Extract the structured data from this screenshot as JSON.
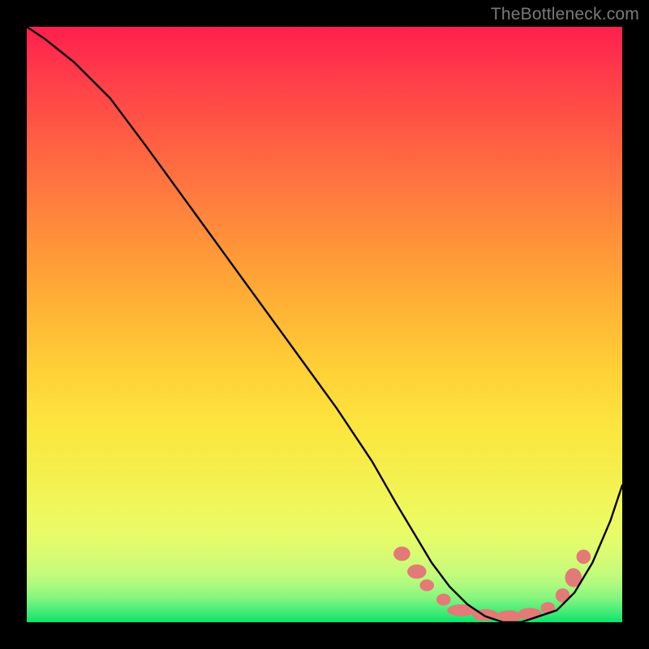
{
  "watermark": "TheBottleneck.com",
  "chart_data": {
    "type": "line",
    "title": "",
    "xlabel": "",
    "ylabel": "",
    "xlim": [
      0,
      100
    ],
    "ylim": [
      0,
      100
    ],
    "grid": false,
    "legend": false,
    "background_gradient": {
      "top": "#ff1f4d",
      "bottom": "#0be36d",
      "description": "vertical red→orange→yellow→green gradient"
    },
    "series": [
      {
        "name": "bottleneck-curve",
        "stroke": "#000000",
        "x": [
          0,
          3,
          8,
          14,
          20,
          28,
          36,
          44,
          52,
          58,
          62,
          65,
          68,
          71,
          74,
          77,
          80,
          83,
          86,
          89,
          92,
          95,
          98,
          100
        ],
        "values": [
          100,
          98,
          94,
          88,
          80,
          69,
          58,
          47,
          36,
          27,
          20,
          15,
          10,
          6,
          3,
          1,
          0,
          0,
          1,
          2,
          5,
          10,
          17,
          23
        ]
      }
    ],
    "markers": [
      {
        "name": "highlight-dots",
        "color": "#e37a77",
        "shape": "ellipse",
        "points": [
          {
            "x": 63.0,
            "y": 11.5,
            "rx": 1.4,
            "ry": 1.2
          },
          {
            "x": 65.5,
            "y": 8.5,
            "rx": 1.6,
            "ry": 1.2
          },
          {
            "x": 67.2,
            "y": 6.2,
            "rx": 1.2,
            "ry": 1.0
          },
          {
            "x": 70.0,
            "y": 3.8,
            "rx": 1.2,
            "ry": 1.0
          },
          {
            "x": 73.0,
            "y": 2.0,
            "rx": 2.4,
            "ry": 1.0
          },
          {
            "x": 77.0,
            "y": 1.2,
            "rx": 2.2,
            "ry": 1.0
          },
          {
            "x": 81.0,
            "y": 1.0,
            "rx": 2.2,
            "ry": 1.0
          },
          {
            "x": 84.5,
            "y": 1.4,
            "rx": 2.0,
            "ry": 1.0
          },
          {
            "x": 87.5,
            "y": 2.4,
            "rx": 1.2,
            "ry": 1.0
          },
          {
            "x": 90.0,
            "y": 4.5,
            "rx": 1.2,
            "ry": 1.2
          },
          {
            "x": 91.8,
            "y": 7.5,
            "rx": 1.4,
            "ry": 1.6
          },
          {
            "x": 93.5,
            "y": 11.0,
            "rx": 1.2,
            "ry": 1.2
          }
        ]
      }
    ]
  }
}
